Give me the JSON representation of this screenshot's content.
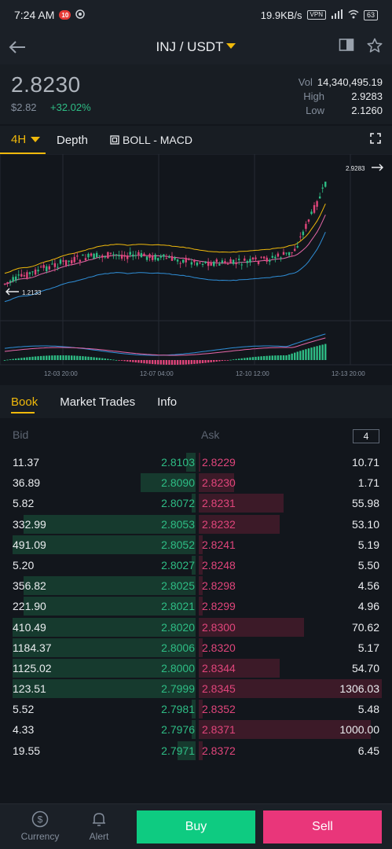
{
  "status_bar": {
    "time": "7:24 AM",
    "badge": "10",
    "network_speed": "19.9KB/s",
    "vpn": "VPN",
    "battery": "63"
  },
  "header": {
    "pair": "INJ / USDT"
  },
  "ticker": {
    "last_price": "2.8230",
    "usd_price": "$2.82",
    "change": "+32.02%",
    "vol_label": "Vol",
    "vol_value": "14,340,495.19",
    "high_label": "High",
    "high_value": "2.9283",
    "low_label": "Low",
    "low_value": "2.1260"
  },
  "chart_tabs": {
    "interval": "4H",
    "depth": "Depth",
    "indicators": "BOLL - MACD"
  },
  "chart_data": {
    "type": "candlestick",
    "max_marker": "2.9283",
    "min_marker": "1.2133",
    "x_ticks": [
      "12-03 20:00",
      "12-07 04:00",
      "12-10 12:00",
      "12-13 20:00"
    ],
    "grid": true,
    "colors": {
      "up": "#2ebd85",
      "down": "#e0457b",
      "upper_band": "#f0b90b",
      "mid_band": "#e667a8",
      "lower_band": "#2f8fd8"
    }
  },
  "book_tabs": [
    "Book",
    "Market Trades",
    "Info"
  ],
  "order_book": {
    "bid_label": "Bid",
    "ask_label": "Ask",
    "precision": "4",
    "rows": [
      {
        "bid_qty": "11.37",
        "bid_price": "2.8103",
        "ask_price": "2.8229",
        "ask_qty": "10.71",
        "bid_depth": 0.05,
        "ask_depth": 0.01
      },
      {
        "bid_qty": "36.89",
        "bid_price": "2.8090",
        "ask_price": "2.8230",
        "ask_qty": "1.71",
        "bid_depth": 0.3,
        "ask_depth": 0.19
      },
      {
        "bid_qty": "5.82",
        "bid_price": "2.8072",
        "ask_price": "2.8231",
        "ask_qty": "55.98",
        "bid_depth": 0.02,
        "ask_depth": 0.46
      },
      {
        "bid_qty": "332.99",
        "bid_price": "2.8053",
        "ask_price": "2.8232",
        "ask_qty": "53.10",
        "bid_depth": 0.93,
        "ask_depth": 0.44
      },
      {
        "bid_qty": "491.09",
        "bid_price": "2.8052",
        "ask_price": "2.8241",
        "ask_qty": "5.19",
        "bid_depth": 0.99,
        "ask_depth": 0.02
      },
      {
        "bid_qty": "5.20",
        "bid_price": "2.8027",
        "ask_price": "2.8248",
        "ask_qty": "5.50",
        "bid_depth": 0.02,
        "ask_depth": 0.02
      },
      {
        "bid_qty": "356.82",
        "bid_price": "2.8025",
        "ask_price": "2.8298",
        "ask_qty": "4.56",
        "bid_depth": 0.93,
        "ask_depth": 0.02
      },
      {
        "bid_qty": "221.90",
        "bid_price": "2.8021",
        "ask_price": "2.8299",
        "ask_qty": "4.96",
        "bid_depth": 0.93,
        "ask_depth": 0.02
      },
      {
        "bid_qty": "410.49",
        "bid_price": "2.8020",
        "ask_price": "2.8300",
        "ask_qty": "70.62",
        "bid_depth": 0.99,
        "ask_depth": 0.57
      },
      {
        "bid_qty": "1184.37",
        "bid_price": "2.8006",
        "ask_price": "2.8320",
        "ask_qty": "5.17",
        "bid_depth": 0.99,
        "ask_depth": 0.02
      },
      {
        "bid_qty": "1125.02",
        "bid_price": "2.8000",
        "ask_price": "2.8344",
        "ask_qty": "54.70",
        "bid_depth": 0.99,
        "ask_depth": 0.44
      },
      {
        "bid_qty": "123.51",
        "bid_price": "2.7999",
        "ask_price": "2.8345",
        "ask_qty": "1306.03",
        "bid_depth": 0.99,
        "ask_depth": 0.99
      },
      {
        "bid_qty": "5.52",
        "bid_price": "2.7981",
        "ask_price": "2.8352",
        "ask_qty": "5.48",
        "bid_depth": 0.02,
        "ask_depth": 0.02
      },
      {
        "bid_qty": "4.33",
        "bid_price": "2.7976",
        "ask_price": "2.8371",
        "ask_qty": "1000.00",
        "bid_depth": 0.02,
        "ask_depth": 0.93
      },
      {
        "bid_qty": "19.55",
        "bid_price": "2.7971",
        "ask_price": "2.8372",
        "ask_qty": "6.45",
        "bid_depth": 0.1,
        "ask_depth": 0.02
      }
    ]
  },
  "bottom_nav": {
    "currency": "Currency",
    "alert": "Alert",
    "buy": "Buy",
    "sell": "Sell"
  }
}
